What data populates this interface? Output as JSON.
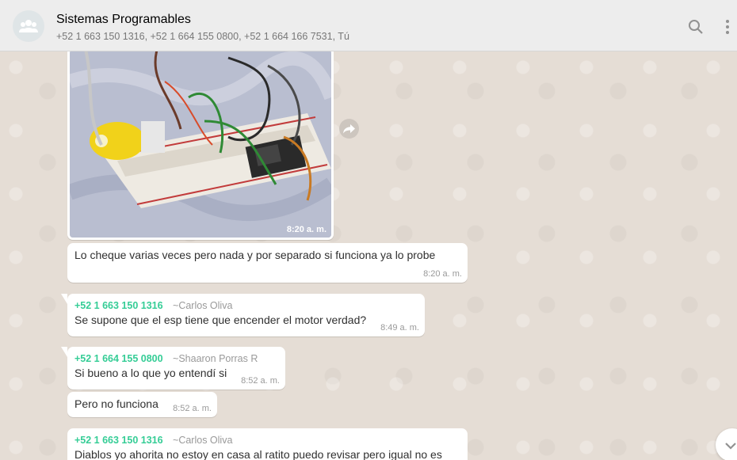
{
  "header": {
    "title": "Sistemas Programables",
    "participants": "+52 1 663 150 1316, +52 1 664 155 0800, +52 1 664 166 7531, Tú",
    "avatar_icon": "group-icon",
    "search_icon": "search-icon",
    "menu_icon": "more-vert-icon"
  },
  "messages": {
    "photo": {
      "time": "8:20 a. m.",
      "forward_icon": "forward-icon"
    },
    "m1": {
      "text": "Lo cheque varias veces pero nada y por separado si funciona ya lo probe",
      "time": "8:20 a. m."
    },
    "m2": {
      "sender": "+52 1 663 150 1316",
      "alias": "~Carlos Oliva",
      "text": "Se supone que el esp tiene que encender el motor verdad?",
      "time": "8:49 a. m."
    },
    "m3": {
      "sender": "+52 1 664 155 0800",
      "alias": "~Shaaron Porras R",
      "text": "Si bueno a lo que yo entendí si",
      "time": "8:52 a. m."
    },
    "m4": {
      "text": "Pero no funciona",
      "time": "8:52 a. m."
    },
    "m5": {
      "sender": "+52 1 663 150 1316",
      "alias": "~Carlos Oliva",
      "text": "Diablos yo ahorita no estoy en casa al ratito puedo revisar pero igual no es"
    }
  },
  "scroll_icon": "chevron-down-icon",
  "colors": {
    "sender": "#35cd96",
    "header_bg": "#ededed",
    "chat_bg": "#e5ddd5"
  }
}
